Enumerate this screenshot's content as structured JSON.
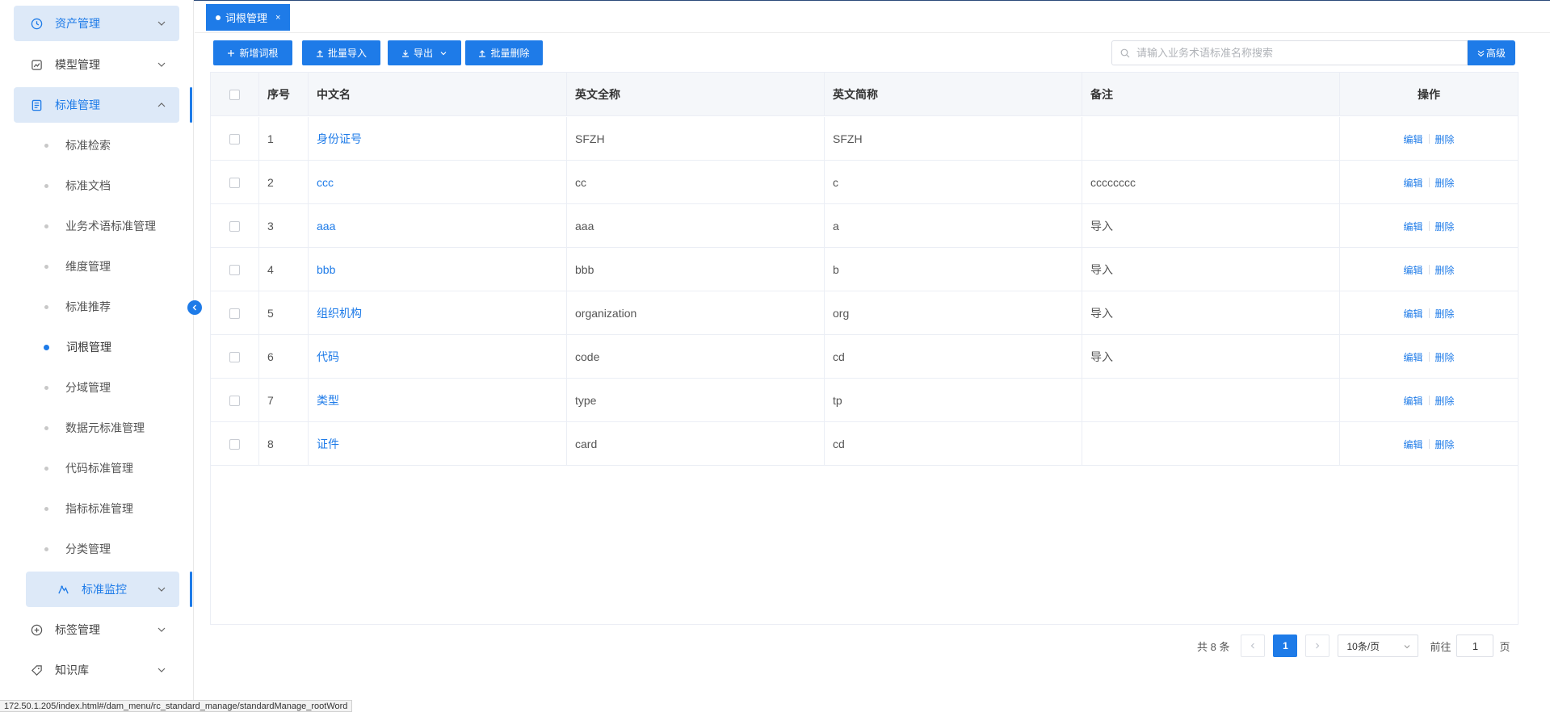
{
  "sidebar": {
    "top_items": [
      {
        "label": "资产管理",
        "icon": "clock-icon"
      },
      {
        "label": "模型管理",
        "icon": "chart-icon"
      },
      {
        "label": "标准管理",
        "icon": "document-icon"
      }
    ],
    "sub_items": [
      {
        "label": "标准检索"
      },
      {
        "label": "标准文档"
      },
      {
        "label": "业务术语标准管理"
      },
      {
        "label": "维度管理"
      },
      {
        "label": "标准推荐"
      },
      {
        "label": "词根管理"
      },
      {
        "label": "分域管理"
      },
      {
        "label": "数据元标准管理"
      },
      {
        "label": "代码标准管理"
      },
      {
        "label": "指标标准管理"
      },
      {
        "label": "分类管理"
      }
    ],
    "monitor_item": {
      "label": "标准监控",
      "icon": "monitor-icon"
    },
    "bottom_items": [
      {
        "label": "标签管理",
        "icon": "plus-circle-icon"
      },
      {
        "label": "知识库",
        "icon": "tag-icon"
      }
    ]
  },
  "tabs": [
    {
      "label": "词根管理",
      "close": "×"
    }
  ],
  "toolbar": {
    "add_label": "新增词根",
    "import_label": "批量导入",
    "export_label": "导出",
    "delete_label": "批量删除"
  },
  "search": {
    "placeholder": "请输入业务术语标准名称搜索",
    "value": "",
    "advanced_label": "高级"
  },
  "table": {
    "headers": {
      "no": "序号",
      "cn": "中文名",
      "en": "英文全称",
      "abbr": "英文简称",
      "note": "备注",
      "op": "操作"
    },
    "rows": [
      {
        "no": "1",
        "cn": "身份证号",
        "en": "SFZH",
        "abbr": "SFZH",
        "note": ""
      },
      {
        "no": "2",
        "cn": "ccc",
        "en": "cc",
        "abbr": "c",
        "note": "cccccccc"
      },
      {
        "no": "3",
        "cn": "aaa",
        "en": "aaa",
        "abbr": "a",
        "note": "导入"
      },
      {
        "no": "4",
        "cn": "bbb",
        "en": "bbb",
        "abbr": "b",
        "note": "导入"
      },
      {
        "no": "5",
        "cn": "组织机构",
        "en": "organization",
        "abbr": "org",
        "note": "导入"
      },
      {
        "no": "6",
        "cn": "代码",
        "en": "code",
        "abbr": "cd",
        "note": "导入"
      },
      {
        "no": "7",
        "cn": "类型",
        "en": "type",
        "abbr": "tp",
        "note": ""
      },
      {
        "no": "8",
        "cn": "证件",
        "en": "card",
        "abbr": "cd",
        "note": ""
      }
    ],
    "edit_label": "编辑",
    "delete_label": "删除"
  },
  "pagination": {
    "total_text": "共 8 条",
    "current_page": "1",
    "page_size": "10条/页",
    "goto_prefix": "前往",
    "goto_value": "1",
    "goto_suffix": "页"
  },
  "statusbar": {
    "url": "172.50.1.205/index.html#/dam_menu/rc_standard_manage/standardManage_rootWord"
  },
  "colors": {
    "accent": "#1e7be8",
    "active_bg": "#dde9f8"
  }
}
